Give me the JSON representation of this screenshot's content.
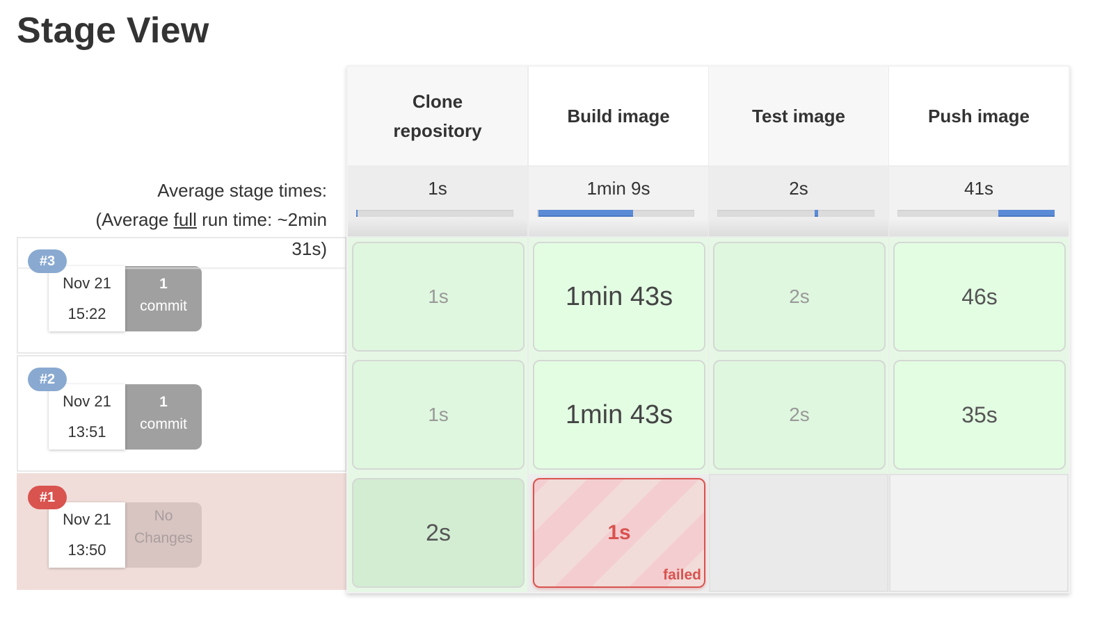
{
  "page": {
    "title": "Stage View"
  },
  "summary": {
    "average_label": "Average stage times:",
    "full_run_prefix": "(Average ",
    "full_run_link": "full",
    "full_run_suffix": " run time: ~2min",
    "full_run_suffix2": "31s)"
  },
  "colors": {
    "success_bg": "#dff7df",
    "failed": "#d9534f",
    "progress": "#5b8bd6",
    "build_badge": "#89a9d0"
  },
  "stages": [
    {
      "name": "Clone repository",
      "avg": "1s",
      "progress": {
        "offset_pct": 0,
        "width_pct": 1
      }
    },
    {
      "name": "Build image",
      "avg": "1min 9s",
      "progress": {
        "offset_pct": 1,
        "width_pct": 60
      }
    },
    {
      "name": "Test image",
      "avg": "2s",
      "progress": {
        "offset_pct": 62,
        "width_pct": 2
      }
    },
    {
      "name": "Push image",
      "avg": "41s",
      "progress": {
        "offset_pct": 64,
        "width_pct": 36
      }
    }
  ],
  "runs": [
    {
      "number": "#3",
      "date": "Nov 21",
      "time": "15:22",
      "changes_count": "1",
      "changes_label": "commit",
      "status": "success",
      "cells": [
        {
          "text": "1s",
          "status": "success"
        },
        {
          "text": "1min 43s",
          "status": "success"
        },
        {
          "text": "2s",
          "status": "success"
        },
        {
          "text": "46s",
          "status": "success"
        }
      ]
    },
    {
      "number": "#2",
      "date": "Nov 21",
      "time": "13:51",
      "changes_count": "1",
      "changes_label": "commit",
      "status": "success",
      "cells": [
        {
          "text": "1s",
          "status": "success"
        },
        {
          "text": "1min 43s",
          "status": "success"
        },
        {
          "text": "2s",
          "status": "success"
        },
        {
          "text": "35s",
          "status": "success"
        }
      ]
    },
    {
      "number": "#1",
      "date": "Nov 21",
      "time": "13:50",
      "changes_count": "No",
      "changes_label": "Changes",
      "status": "failed",
      "cells": [
        {
          "text": "2s",
          "status": "success"
        },
        {
          "text": "1s",
          "status": "failed",
          "label": "failed"
        },
        {
          "text": "",
          "status": "empty"
        },
        {
          "text": "",
          "status": "empty"
        }
      ]
    }
  ]
}
